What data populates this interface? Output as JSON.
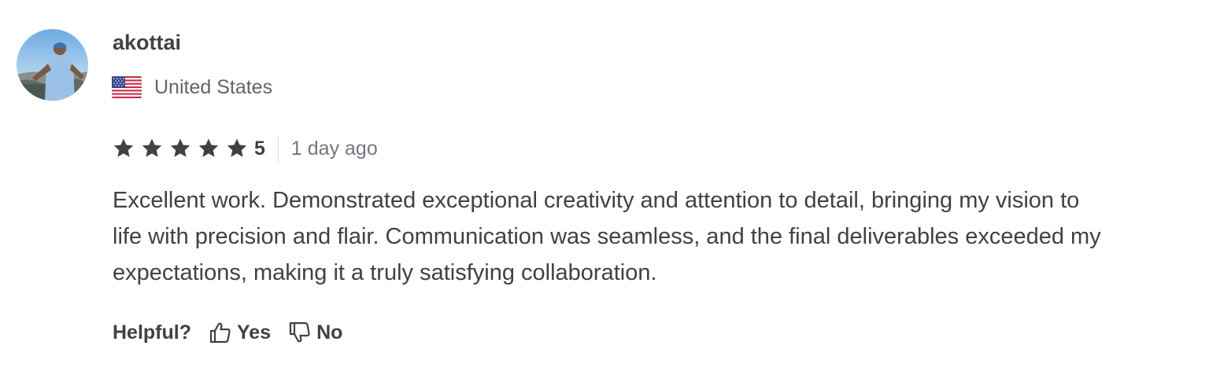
{
  "review": {
    "username": "akottai",
    "country": "United States",
    "country_flag_icon": "us-flag-icon",
    "rating": {
      "stars_filled": 5,
      "stars_total": 5,
      "value": "5",
      "star_color": "#404145"
    },
    "time_ago": "1 day ago",
    "text": "Excellent work. Demonstrated exceptional creativity and attention to detail, bringing my vision to life with precision and flair. Communication was seamless, and the final deliverables exceeded my expectations, making it a truly satisfying collaboration.",
    "helpful": {
      "label": "Helpful?",
      "yes_label": "Yes",
      "yes_icon": "thumbs-up-icon",
      "no_label": "No",
      "no_icon": "thumbs-down-icon"
    }
  }
}
